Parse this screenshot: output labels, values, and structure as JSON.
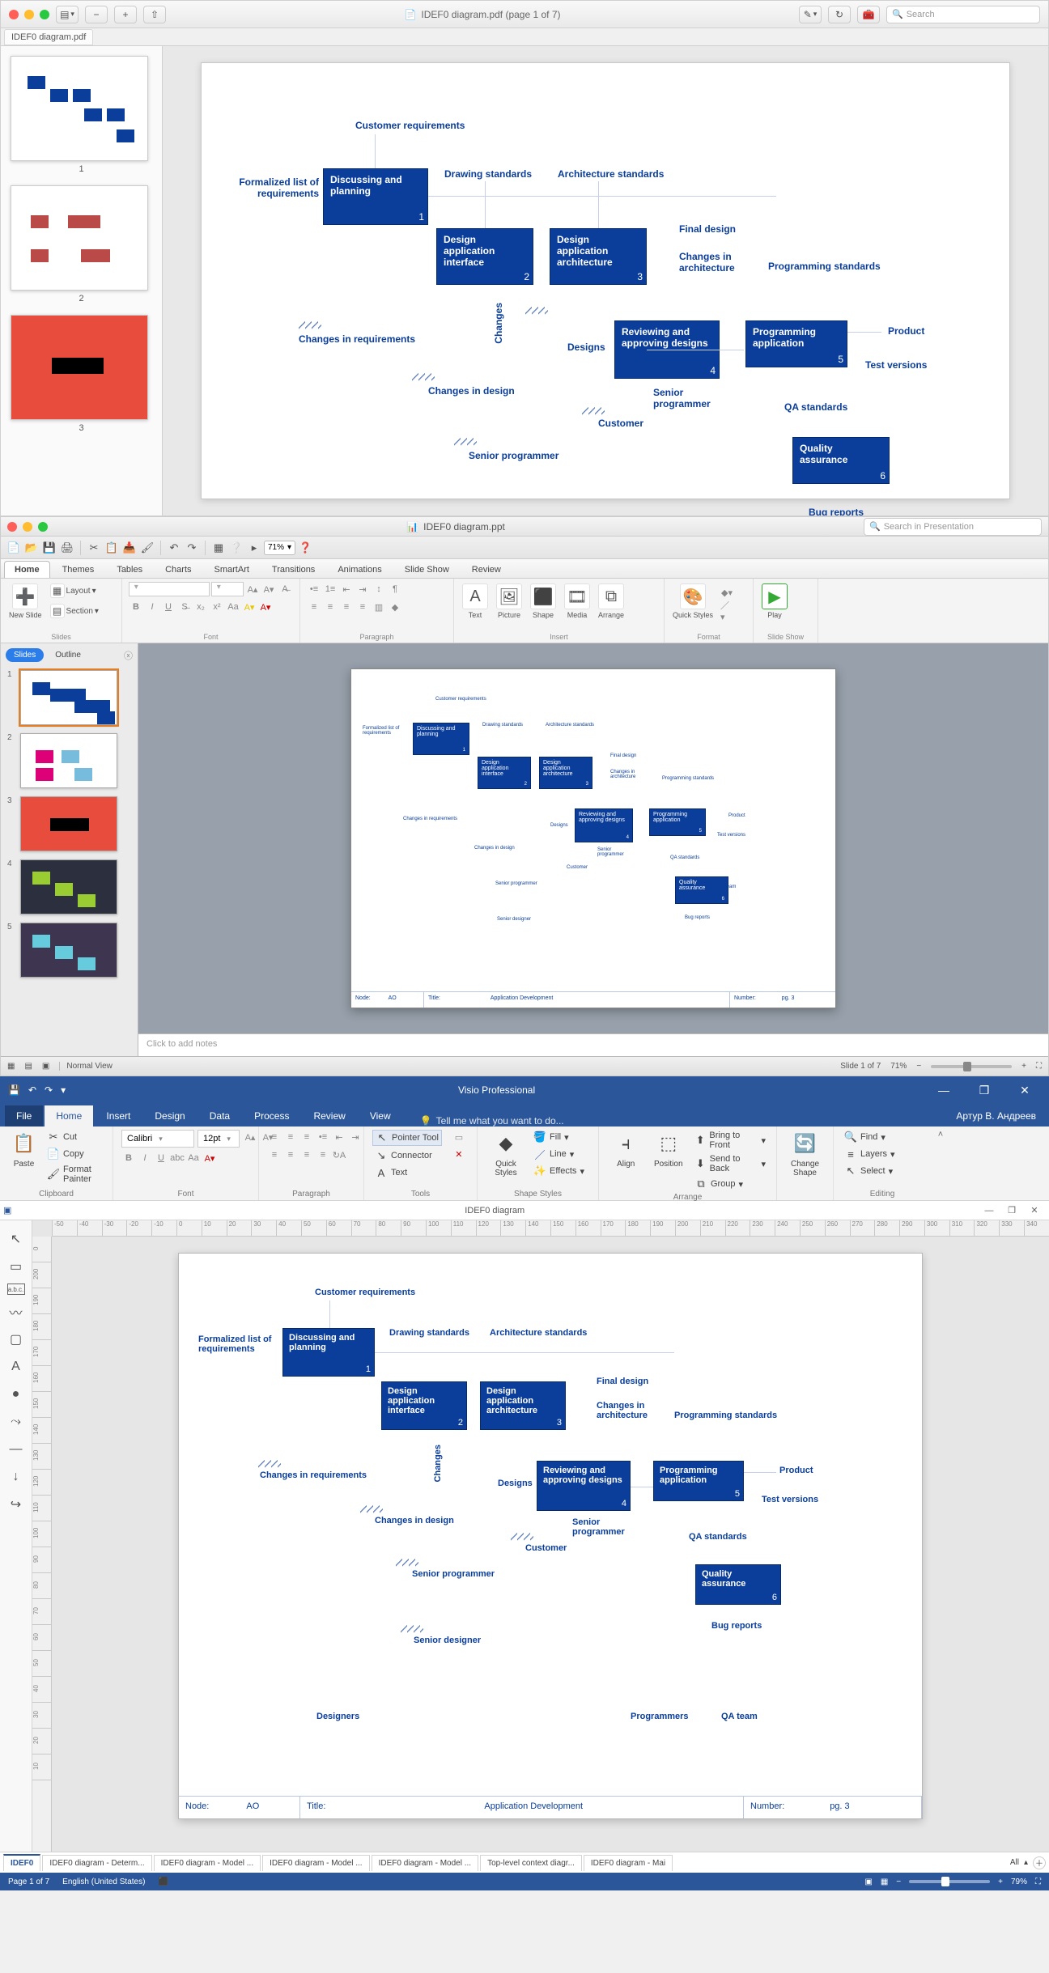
{
  "preview": {
    "title_prefix": "IDEF0 diagram.pdf (page 1 of 7)",
    "tab": "IDEF0 diagram.pdf",
    "search_placeholder": "Search",
    "thumbs": [
      "1",
      "2",
      "3"
    ]
  },
  "diagram": {
    "boxes": [
      {
        "id": 1,
        "label": "Discussing and planning",
        "num": "1"
      },
      {
        "id": 2,
        "label": "Design application interface",
        "num": "2"
      },
      {
        "id": 3,
        "label": "Design application architecture",
        "num": "3"
      },
      {
        "id": 4,
        "label": "Reviewing and approving designs",
        "num": "4"
      },
      {
        "id": 5,
        "label": "Programming application",
        "num": "5"
      },
      {
        "id": 6,
        "label": "Quality assurance",
        "num": "6"
      }
    ],
    "labels": {
      "cust_req": "Customer requirements",
      "form_list": "Formalized list of requirements",
      "draw_std": "Drawing standards",
      "arch_std": "Architecture standards",
      "final_design": "Final design",
      "chg_arch": "Changes in architecture",
      "prog_std": "Programming standards",
      "chg_req": "Changes in requirements",
      "chg_design": "Changes in design",
      "designs": "Designs",
      "senior_prog": "Senior programmer",
      "senior_prog2": "Senior programmer",
      "customer": "Customer",
      "qa_std": "QA standards",
      "product": "Product",
      "test_ver": "Test versions",
      "bug_rep": "Bug reports",
      "changes": "Changes",
      "senior_designer": "Senior designer",
      "designers": "Designers",
      "programmers": "Programmers",
      "qa_team": "QA team"
    },
    "footer": {
      "node_lbl": "Node:",
      "node": "AO",
      "title_lbl": "Title:",
      "title": "Application Development",
      "num_lbl": "Number:",
      "num": "pg. 3"
    }
  },
  "ppt": {
    "title": "IDEF0 diagram.ppt",
    "search_placeholder": "Search in Presentation",
    "zoom": "71%",
    "tabs": [
      "Home",
      "Themes",
      "Tables",
      "Charts",
      "SmartArt",
      "Transitions",
      "Animations",
      "Slide Show",
      "Review"
    ],
    "groups": [
      "Slides",
      "Font",
      "Paragraph",
      "Insert",
      "Format",
      "Slide Show"
    ],
    "slides_btn": {
      "new": "New Slide",
      "layout": "Layout",
      "section": "Section"
    },
    "insert": [
      "Text",
      "Picture",
      "Shape",
      "Media",
      "Arrange"
    ],
    "format": "Quick Styles",
    "play": "Play",
    "sidebar_tabs": [
      "Slides",
      "Outline"
    ],
    "notes": "Click to add notes",
    "status_view": "Normal View",
    "status_slide": "Slide 1 of 7",
    "status_zoom": "71%"
  },
  "visio": {
    "title": "Visio Professional",
    "user": "Артур В. Андреев",
    "tabs": [
      "File",
      "Home",
      "Insert",
      "Design",
      "Data",
      "Process",
      "Review",
      "View"
    ],
    "tellme": "Tell me what you want to do...",
    "clipboard": {
      "paste": "Paste",
      "cut": "Cut",
      "copy": "Copy",
      "fp": "Format Painter",
      "group": "Clipboard"
    },
    "font": {
      "name": "Calibri",
      "size": "12pt",
      "group": "Font"
    },
    "paragraph": {
      "group": "Paragraph"
    },
    "tools": {
      "pointer": "Pointer Tool",
      "connector": "Connector",
      "text": "Text",
      "group": "Tools"
    },
    "shape_styles": {
      "quick": "Quick Styles",
      "fill": "Fill",
      "line": "Line",
      "effects": "Effects",
      "group": "Shape Styles"
    },
    "arrange": {
      "align": "Align",
      "position": "Position",
      "btf": "Bring to Front",
      "stb": "Send to Back",
      "grp": "Group",
      "group": "Arrange"
    },
    "change": {
      "change": "Change Shape",
      "group": ""
    },
    "editing": {
      "find": "Find",
      "layers": "Layers",
      "select": "Select",
      "group": "Editing"
    },
    "doc_title": "IDEF0 diagram",
    "sheets": [
      "IDEF0",
      "IDEF0 diagram - Determ...",
      "IDEF0 diagram - Model ...",
      "IDEF0 diagram - Model ...",
      "IDEF0 diagram - Model ...",
      "Top-level context diagr...",
      "IDEF0 diagram - Mai"
    ],
    "sheet_all": "All",
    "status_page": "Page 1 of 7",
    "status_lang": "English (United States)",
    "status_zoom": "79%",
    "ruler_ticks_h": [
      "-50",
      "-40",
      "-30",
      "-20",
      "-10",
      "0",
      "10",
      "20",
      "30",
      "40",
      "50",
      "60",
      "70",
      "80",
      "90",
      "100",
      "110",
      "120",
      "130",
      "140",
      "150",
      "160",
      "170",
      "180",
      "190",
      "200",
      "210",
      "220",
      "230",
      "240",
      "250",
      "260",
      "270",
      "280",
      "290",
      "300",
      "310",
      "320",
      "330",
      "340"
    ],
    "ruler_ticks_v": [
      "0",
      "200",
      "190",
      "180",
      "170",
      "160",
      "150",
      "140",
      "130",
      "120",
      "110",
      "100",
      "90",
      "80",
      "70",
      "60",
      "50",
      "40",
      "30",
      "20",
      "10"
    ]
  }
}
